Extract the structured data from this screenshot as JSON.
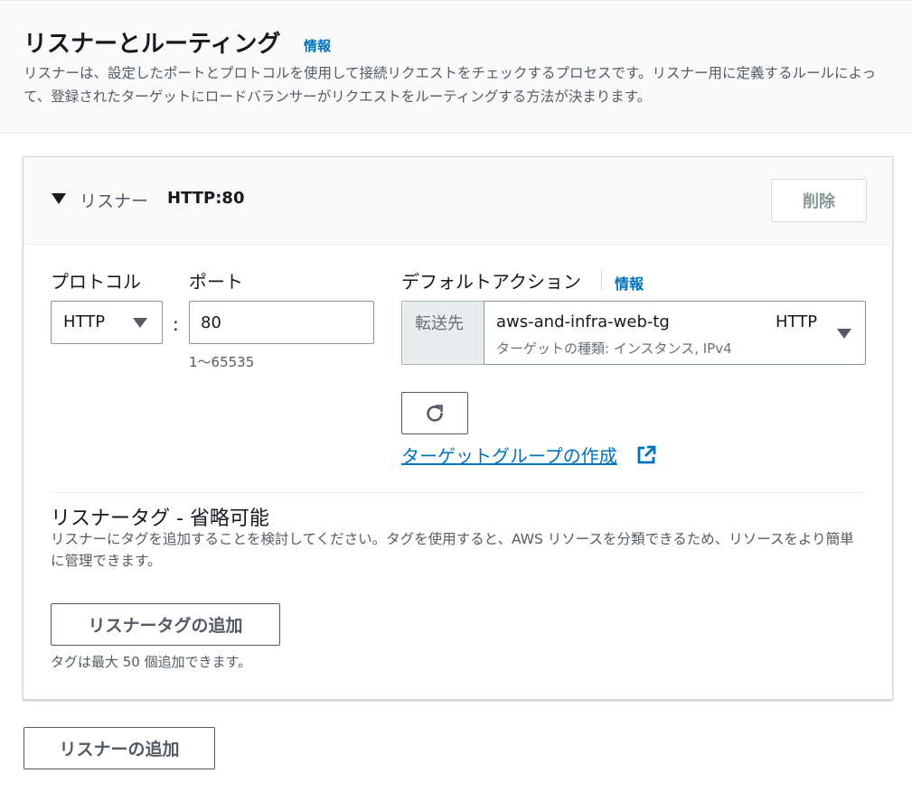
{
  "section": {
    "title": "リスナーとルーティング",
    "info": "情報",
    "description": "リスナーは、設定したポートとプロトコルを使用して接続リクエストをチェックするプロセスです。リスナー用に定義するルールによって、登録されたターゲットにロードバランサーがリクエストをルーティングする方法が決まります。"
  },
  "listener": {
    "label": "リスナー",
    "value": "HTTP:80",
    "delete_label": "削除",
    "protocol": {
      "label": "プロトコル",
      "selected": "HTTP"
    },
    "separator": ":",
    "port": {
      "label": "ポート",
      "value": "80",
      "hint": "1〜65535"
    },
    "default_action": {
      "label": "デフォルトアクション",
      "info": "情報",
      "addon": "転送先",
      "target_group_name": "aws-and-infra-web-tg",
      "target_group_protocol": "HTTP",
      "target_group_detail": "ターゲットの種類: インスタンス, IPv4",
      "create_link": "ターゲットグループの作成"
    },
    "tags": {
      "title": "リスナータグ - 省略可能",
      "description": "リスナーにタグを追加することを検討してください。タグを使用すると、AWS リソースを分類できるため、リソースをより簡単に管理できます。",
      "add_label": "リスナータグの追加",
      "hint": "タグは最大 50 個追加できます。"
    }
  },
  "add_listener_label": "リスナーの追加",
  "icons": {
    "expand": "caret-down-icon",
    "refresh": "refresh-icon",
    "external": "external-link-icon",
    "dropdown": "triangle-down-icon"
  },
  "colors": {
    "link": "#0073bb",
    "text": "#16191f",
    "secondary": "#545b64"
  }
}
